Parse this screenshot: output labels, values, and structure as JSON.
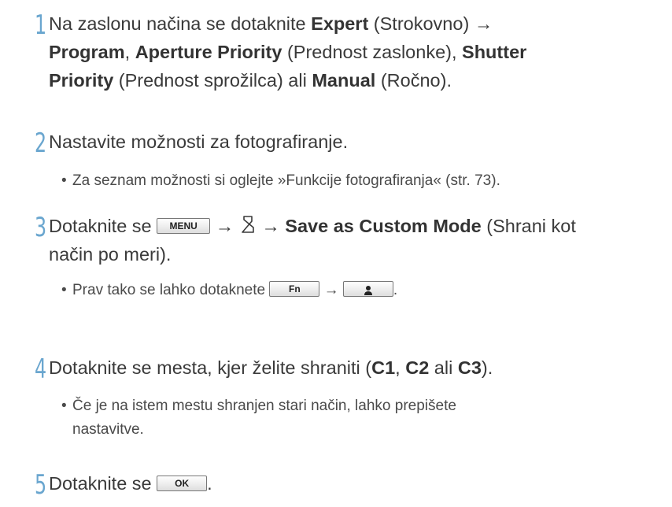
{
  "steps": [
    {
      "number": "1",
      "parts": {
        "a": "Na zaslonu načina se dotaknite ",
        "b": "Expert",
        "c": " (Strokovno) →",
        "d": "Program",
        "e": ", ",
        "f": "Aperture Priority",
        "g": " (Prednost zaslonke), ",
        "h": "Shutter",
        "i": "Priority",
        "j": " (Prednost sprožilca) ali ",
        "k": "Manual",
        "l": " (Ročno)."
      }
    },
    {
      "number": "2",
      "text": "Nastavite možnosti za fotografiranje.",
      "bullet": "Za seznam možnosti si oglejte »Funkcije fotografiranja« (str. 73)."
    },
    {
      "number": "3",
      "parts": {
        "a": "Dotaknite se ",
        "b": " → ",
        "c": " → ",
        "d": "Save as Custom Mode",
        "e": " (Shrani kot",
        "f": "način po meri)."
      },
      "bullet": {
        "a": "Prav tako se lahko dotaknete ",
        "b": " → ",
        "c": "."
      }
    },
    {
      "number": "4",
      "parts": {
        "a": "Dotaknite se mesta, kjer želite shraniti (",
        "b": "C1",
        "c": ", ",
        "d": "C2",
        "e": " ali ",
        "f": "C3",
        "g": ")."
      },
      "bullet": {
        "line1": "Če je na istem mestu shranjen stari način, lahko prepišete",
        "line2": "nastavitve."
      }
    },
    {
      "number": "5",
      "parts": {
        "a": "Dotaknite se ",
        "b": "."
      }
    }
  ],
  "keys": {
    "menu": "MENU",
    "fn": "Fn",
    "ok": "OK"
  },
  "icons": {
    "custom_mode": "custom-mode-icon",
    "person": "person-icon"
  },
  "colors": {
    "step_number": "#6aa6cf",
    "text": "#3a3a3a"
  }
}
